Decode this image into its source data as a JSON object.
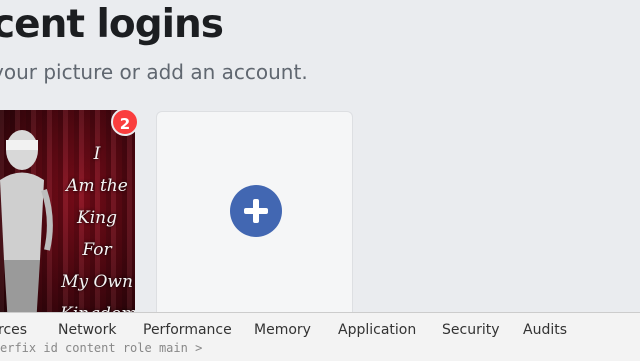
{
  "header": {
    "title": "cent logins",
    "subtitle": "your picture or add an account."
  },
  "profile": {
    "notification_count": "2",
    "photo_text": "I\nAm the\nKing\nFor\nMy Own\nKingdom"
  },
  "add_account": {
    "icon": "plus-circle-icon",
    "accent_color": "#4267b2"
  },
  "devtools": {
    "tabs": [
      "rces",
      "Network",
      "Performance",
      "Memory",
      "Application",
      "Security",
      "Audits"
    ],
    "code_line": "erfix  id  content  role  main  >"
  }
}
